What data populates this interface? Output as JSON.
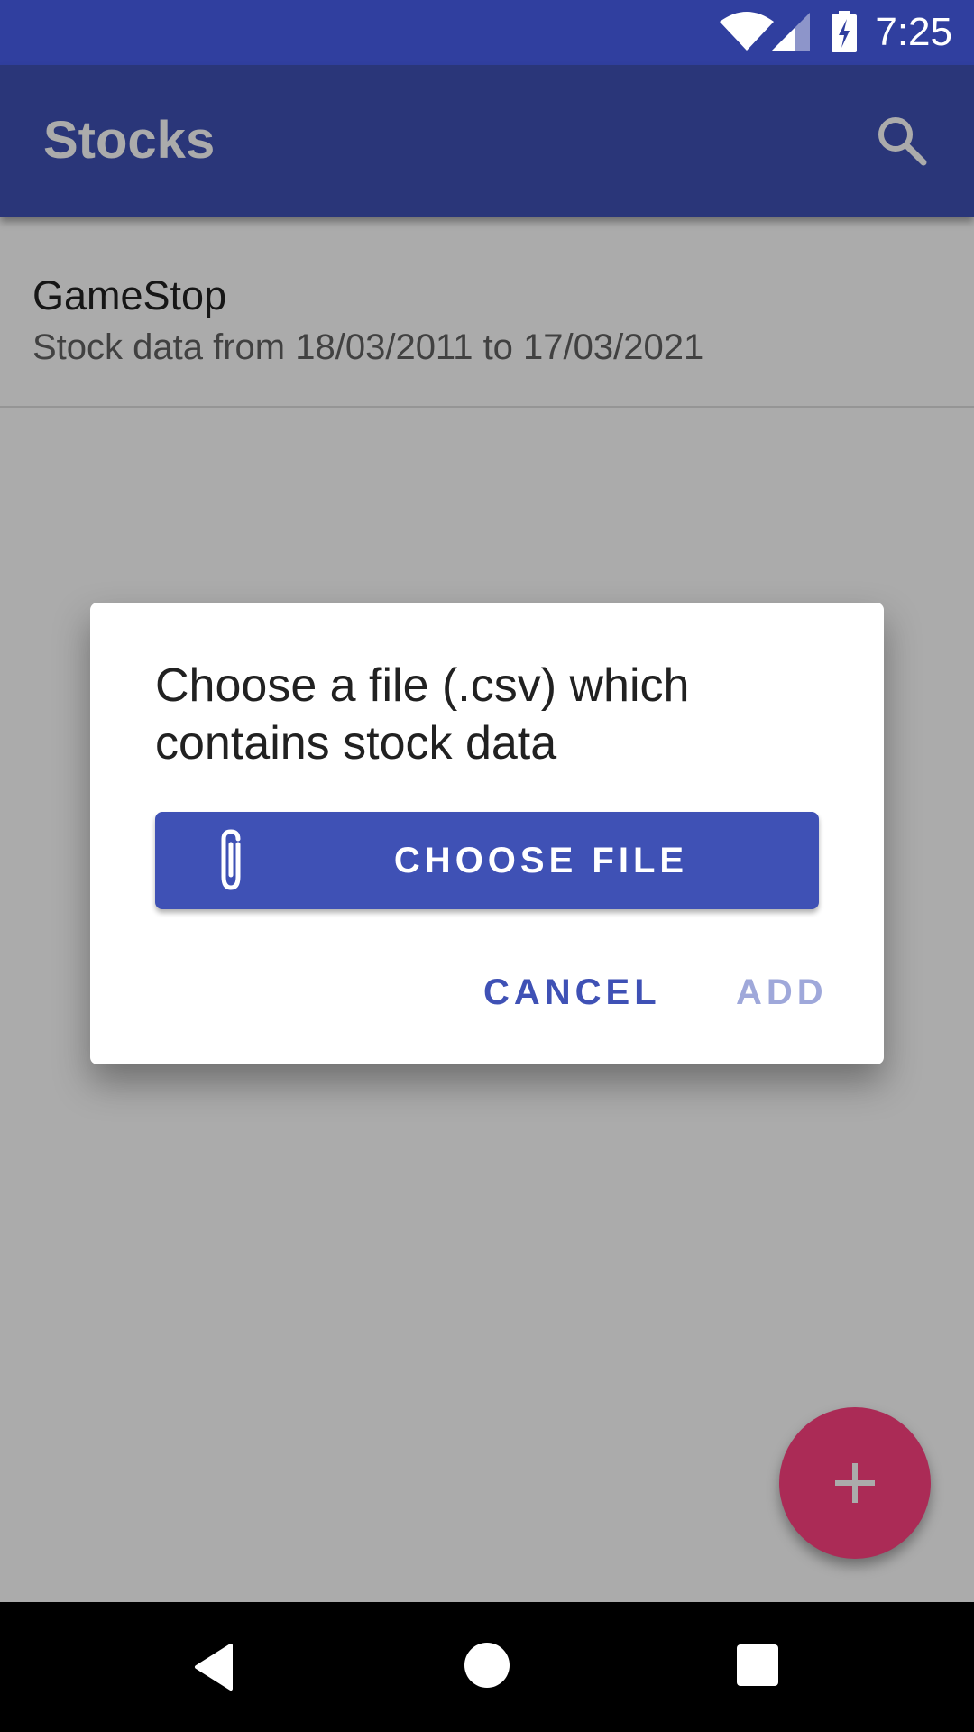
{
  "status_bar": {
    "time": "7:25",
    "icons": [
      "wifi-icon",
      "signal-icon",
      "battery-charging-icon"
    ]
  },
  "app_bar": {
    "title": "Stocks",
    "search_icon": "search-icon"
  },
  "stock_list": {
    "items": [
      {
        "title": "GameStop",
        "subtitle": "Stock data from 18/03/2011 to 17/03/2021"
      }
    ]
  },
  "dialog": {
    "title": "Choose a file (.csv) which contains stock data",
    "choose_file_button": {
      "icon": "paperclip-icon",
      "label": "CHOOSE FILE"
    },
    "cancel_label": "CANCEL",
    "add_label": "ADD",
    "add_enabled": false
  },
  "fab": {
    "icon": "plus-icon"
  },
  "nav_bar": {
    "icons": [
      "back-icon",
      "home-icon",
      "recents-icon"
    ]
  },
  "colors": {
    "primary": "#3F51B5",
    "primary_dark": "#303F9F",
    "accent": "#FF4081",
    "disabled_action": "#9FA8DA"
  }
}
